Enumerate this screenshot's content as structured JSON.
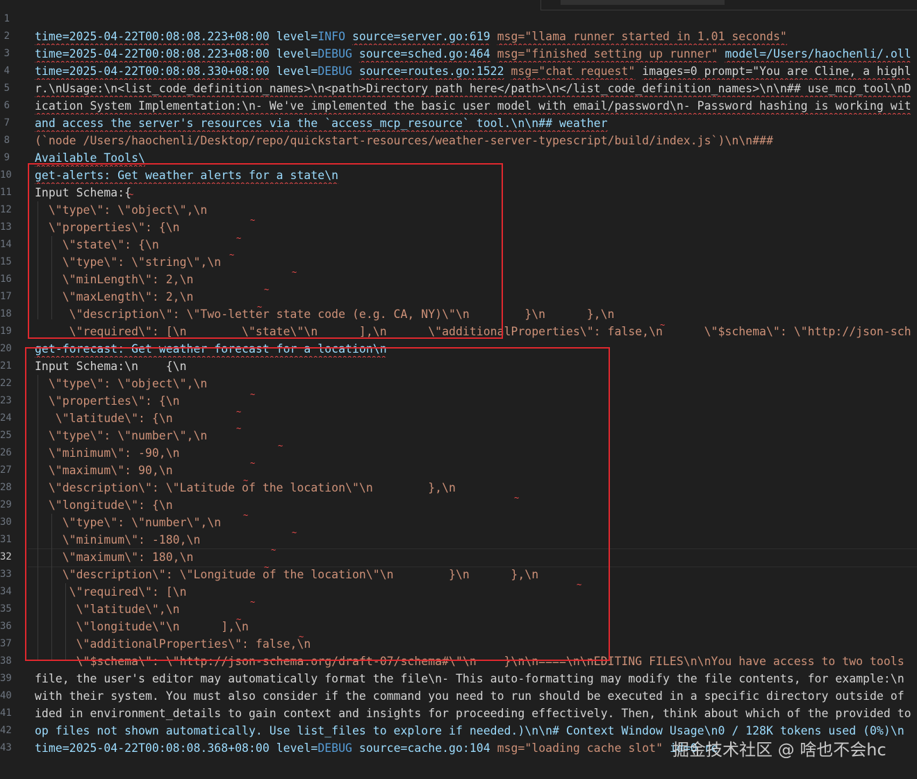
{
  "editor": {
    "active_line": "32",
    "line_numbers": [
      "1",
      "2",
      "3",
      "4",
      "5",
      "6",
      "7",
      "8",
      "9",
      "10",
      "11",
      "12",
      "13",
      "14",
      "15",
      "16",
      "17",
      "18",
      "19",
      "20",
      "21",
      "22",
      "23",
      "24",
      "25",
      "26",
      "27",
      "28",
      "29",
      "30",
      "31",
      "32",
      "33",
      "34",
      "35",
      "36",
      "37",
      "38",
      "39",
      "40",
      "41",
      "42",
      "43"
    ],
    "lines": {
      "l2": {
        "time": "time=2025-04-22T00:08:08.223+08:00",
        "level_key": "level=",
        "level": "INFO",
        "source": "source=server.go:619",
        "msg": "msg=\"llama runner started in 1.01 seconds\""
      },
      "l3": {
        "time": "time=2025-04-22T00:08:08.223+08:00",
        "level_key": "level=",
        "level": "DEBUG",
        "source": "source=sched.go:464",
        "msg": "msg=\"finished setting up runner\"",
        "extra": "model=/Users/haochenli/.oll"
      },
      "l4": {
        "time": "time=2025-04-22T00:08:08.330+08:00",
        "level_key": "level=",
        "level": "DEBUG",
        "source": "source=routes.go:1522",
        "msg": "msg=\"chat request\"",
        "extra": "images=0 prompt=\"You are Cline, a highl"
      },
      "l5": "r.\\nUsage:\\n<list_code_definition_names>\\n<path>Directory path here</path>\\n</list_code_definition_names>\\n\\n## use_mcp_tool\\nD",
      "l6": "ication System Implementation:\\n- We've implemented the basic user model with email/password\\n- Password hashing is working wit",
      "l7": "and access the server's resources via the `access_mcp_resource` tool.\\n\\n## weather",
      "l8": "(`node /Users/haochenli/Desktop/repo/quickstart-resources/weather-server-typescript/build/index.js`)\\n\\n###",
      "l9": "Available Tools\\",
      "l10": "get-alerts: Get weather alerts for a state\\n",
      "l11": "Input Schema:{",
      "l12": "  \\\"type\\\": \\\"object\\\",\\n",
      "l13": "  \\\"properties\\\": {\\n",
      "l14": "    \\\"state\\\": {\\n",
      "l15": "    \\\"type\\\": \\\"string\\\",\\n",
      "l16": "    \\\"minLength\\\": 2,\\n",
      "l17": "    \\\"maxLength\\\": 2,\\n",
      "l18": "     \\\"description\\\": \\\"Two-letter state code (e.g. CA, NY)\\\"\\n        }\\n      },\\n",
      "l19": "     \\\"required\\\": [\\n        \\\"state\\\"\\n      ],\\n      \\\"additionalProperties\\\": false,\\n      \\\"$schema\\\": \\\"http://json-sch",
      "l20": "get-forecast: Get weather forecast for a location\\n",
      "l21": "Input Schema:\\n    {\\n",
      "l22": "  \\\"type\\\": \\\"object\\\",\\n",
      "l23": "  \\\"properties\\\": {\\n",
      "l24": "   \\\"latitude\\\": {\\n",
      "l25": "  \\\"type\\\": \\\"number\\\",\\n",
      "l26": "  \\\"minimum\\\": -90,\\n",
      "l27": "  \\\"maximum\\\": 90,\\n",
      "l28": "  \\\"description\\\": \\\"Latitude of the location\\\"\\n        },\\n",
      "l29": "  \\\"longitude\\\": {\\n",
      "l30": "    \\\"type\\\": \\\"number\\\",\\n",
      "l31": "    \\\"minimum\\\": -180,\\n",
      "l32": "    \\\"maximum\\\": 180,\\n",
      "l33": "    \\\"description\\\": \\\"Longitude of the location\\\"\\n        }\\n      },\\n",
      "l34": "     \\\"required\\\": [\\n",
      "l35": "      \\\"latitude\\\",\\n",
      "l36": "      \\\"longitude\\\"\\n      ],\\n",
      "l37": "      \\\"additionalProperties\\\": false,\\n",
      "l38": "      \\\"$schema\\\": \\\"http://json-schema.org/draft-07/schema#\\\"\\n    }\\n\\n====\\n\\nEDITING FILES\\n\\nYou have access to two tools",
      "l39": "file, the user's editor may automatically format the file\\n- This auto-formatting may modify the file contents, for example:\\n",
      "l40": "with their system. You must also consider if the command you need to run should be executed in a specific directory outside of",
      "l41": "ided in environment_details to gain context and insights for proceeding effectively. Then, think about which of the provided to",
      "l42": "op files not shown automatically. Use list_files to explore if needed.)\\n\\n# Context Window Usage\\n0 / 128K tokens used (0%)\\n",
      "l43": {
        "time": "time=2025-04-22T00:08:08.368+08:00",
        "level_key": "level=",
        "level": "DEBUG",
        "source": "source=cache.go:104",
        "msg": "msg=\"loading cache slot\"",
        "extra": "id=0 re"
      }
    }
  },
  "watermark": "掘金技术社区 @ 啥也不会hc",
  "colors": {
    "background": "#1f1f1f",
    "highlight_box": "#e0282e",
    "key": "#9cdcfe",
    "string": "#ce9178",
    "keyword": "#569cd6"
  }
}
